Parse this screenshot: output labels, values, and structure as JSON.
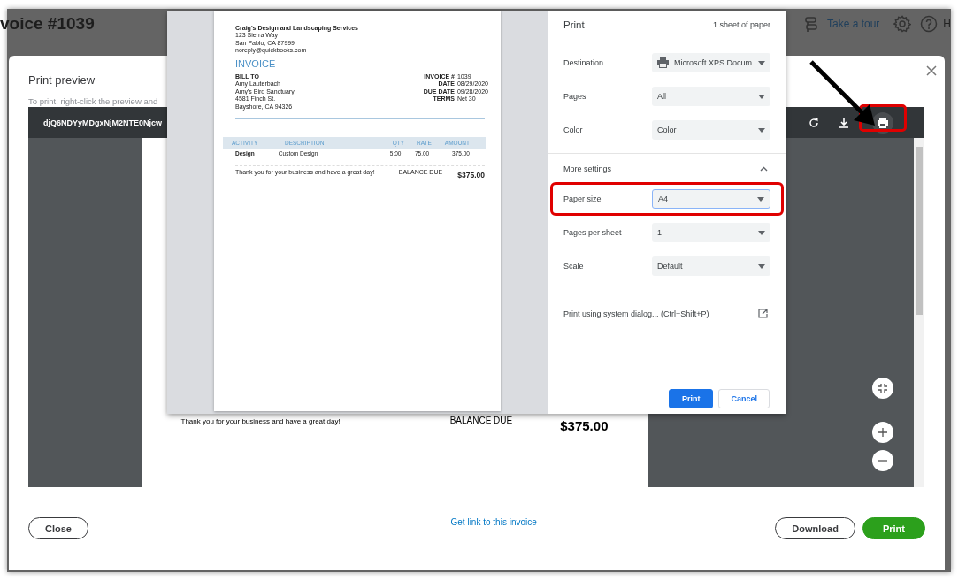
{
  "app": {
    "title": "voice #1039",
    "tour": "Take a tour",
    "help": "H"
  },
  "modal": {
    "title": "Print preview",
    "hint": "To print, right-click the preview and",
    "viewer": {
      "filename": "djQ6NDYyMDgxNjM2NTE0Njcw",
      "print_highlighted": true,
      "thanks": "Thank you for your business and have a great day!",
      "balance_label": "BALANCE DUE",
      "balance": "$375.00"
    },
    "footer": {
      "close": "Close",
      "link": "Get link to this invoice",
      "download": "Download",
      "print": "Print"
    }
  },
  "print_dialog": {
    "invoice": {
      "company": "Craig's Design and Landscaping Services",
      "address": [
        "123 Sierra Way",
        "San Pablo, CA  87999",
        "noreply@quickbooks.com"
      ],
      "heading": "INVOICE",
      "bill_to": "BILL TO",
      "bill_lines": [
        "Amy Lauterbach",
        "Amy's Bird Sanctuary",
        "4581 Finch St.",
        "Bayshore, CA  94326"
      ],
      "meta": [
        {
          "label": "INVOICE #",
          "value": "1039"
        },
        {
          "label": "DATE",
          "value": "08/29/2020"
        },
        {
          "label": "DUE DATE",
          "value": "09/28/2020"
        },
        {
          "label": "TERMS",
          "value": "Net 30"
        }
      ],
      "columns": [
        "ACTIVITY",
        "DESCRIPTION",
        "QTY",
        "RATE",
        "AMOUNT"
      ],
      "rows": [
        [
          "Design",
          "Custom Design",
          "5:00",
          "75.00",
          "375.00"
        ]
      ],
      "thanks": "Thank you for your business and have a great day!",
      "balance_label": "BALANCE DUE",
      "balance": "$375.00"
    },
    "title": "Print",
    "sheets": "1 sheet of paper",
    "settings": [
      {
        "label": "Destination",
        "value": "Microsoft XPS Docum",
        "kind": "printer"
      },
      {
        "label": "Pages",
        "value": "All",
        "kind": "plain"
      },
      {
        "label": "Color",
        "value": "Color",
        "kind": "plain"
      }
    ],
    "more_settings": {
      "label": "More settings",
      "expanded": true
    },
    "more": [
      {
        "label": "Paper size",
        "value": "A4",
        "focused": true,
        "highlighted": true
      },
      {
        "label": "Pages per sheet",
        "value": "1",
        "focused": false,
        "highlighted": false
      },
      {
        "label": "Scale",
        "value": "Default",
        "focused": false,
        "highlighted": false
      }
    ],
    "system_dialog": "Print using system dialog... (Ctrl+Shift+P)",
    "print": "Print",
    "cancel": "Cancel"
  }
}
